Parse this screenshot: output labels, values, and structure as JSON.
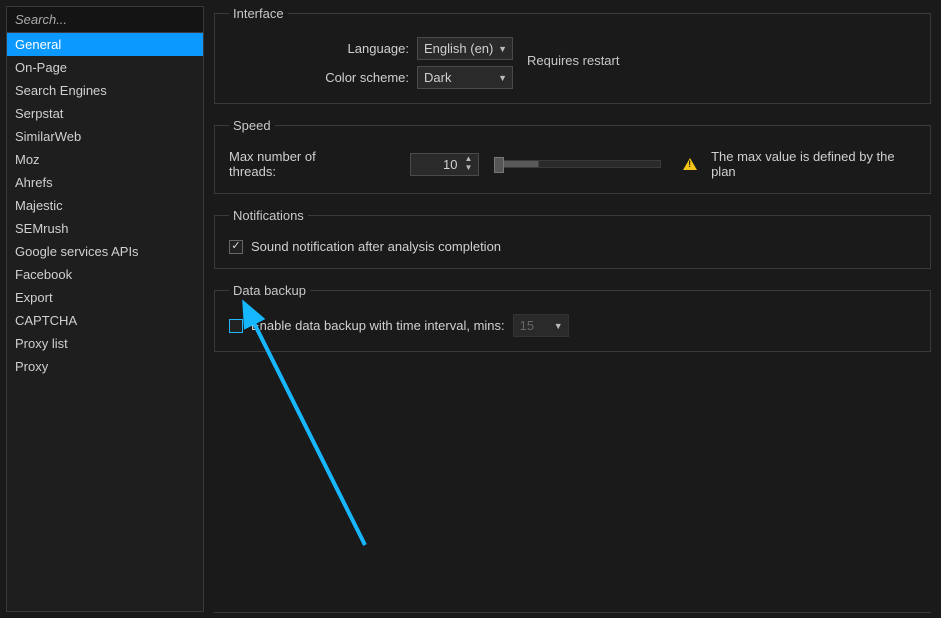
{
  "sidebar": {
    "search_placeholder": "Search...",
    "items": [
      {
        "label": "General",
        "selected": true
      },
      {
        "label": "On-Page"
      },
      {
        "label": "Search Engines"
      },
      {
        "label": "Serpstat"
      },
      {
        "label": "SimilarWeb"
      },
      {
        "label": "Moz"
      },
      {
        "label": "Ahrefs"
      },
      {
        "label": "Majestic"
      },
      {
        "label": "SEMrush"
      },
      {
        "label": "Google services APIs"
      },
      {
        "label": "Facebook"
      },
      {
        "label": "Export"
      },
      {
        "label": "CAPTCHA"
      },
      {
        "label": "Proxy list"
      },
      {
        "label": "Proxy"
      }
    ]
  },
  "interface": {
    "legend": "Interface",
    "language_label": "Language:",
    "language_value": "English (en)",
    "color_scheme_label": "Color scheme:",
    "color_scheme_value": "Dark",
    "requires_restart": "Requires restart"
  },
  "speed": {
    "legend": "Speed",
    "threads_label": "Max number of threads:",
    "threads_value": "10",
    "warn_text": "The max value is defined by the plan"
  },
  "notifications": {
    "legend": "Notifications",
    "sound_checked": true,
    "sound_label": "Sound notification after analysis completion"
  },
  "backup": {
    "legend": "Data backup",
    "enable_checked": false,
    "enable_label": "Enable data backup with time interval, mins:",
    "interval_value": "15"
  }
}
